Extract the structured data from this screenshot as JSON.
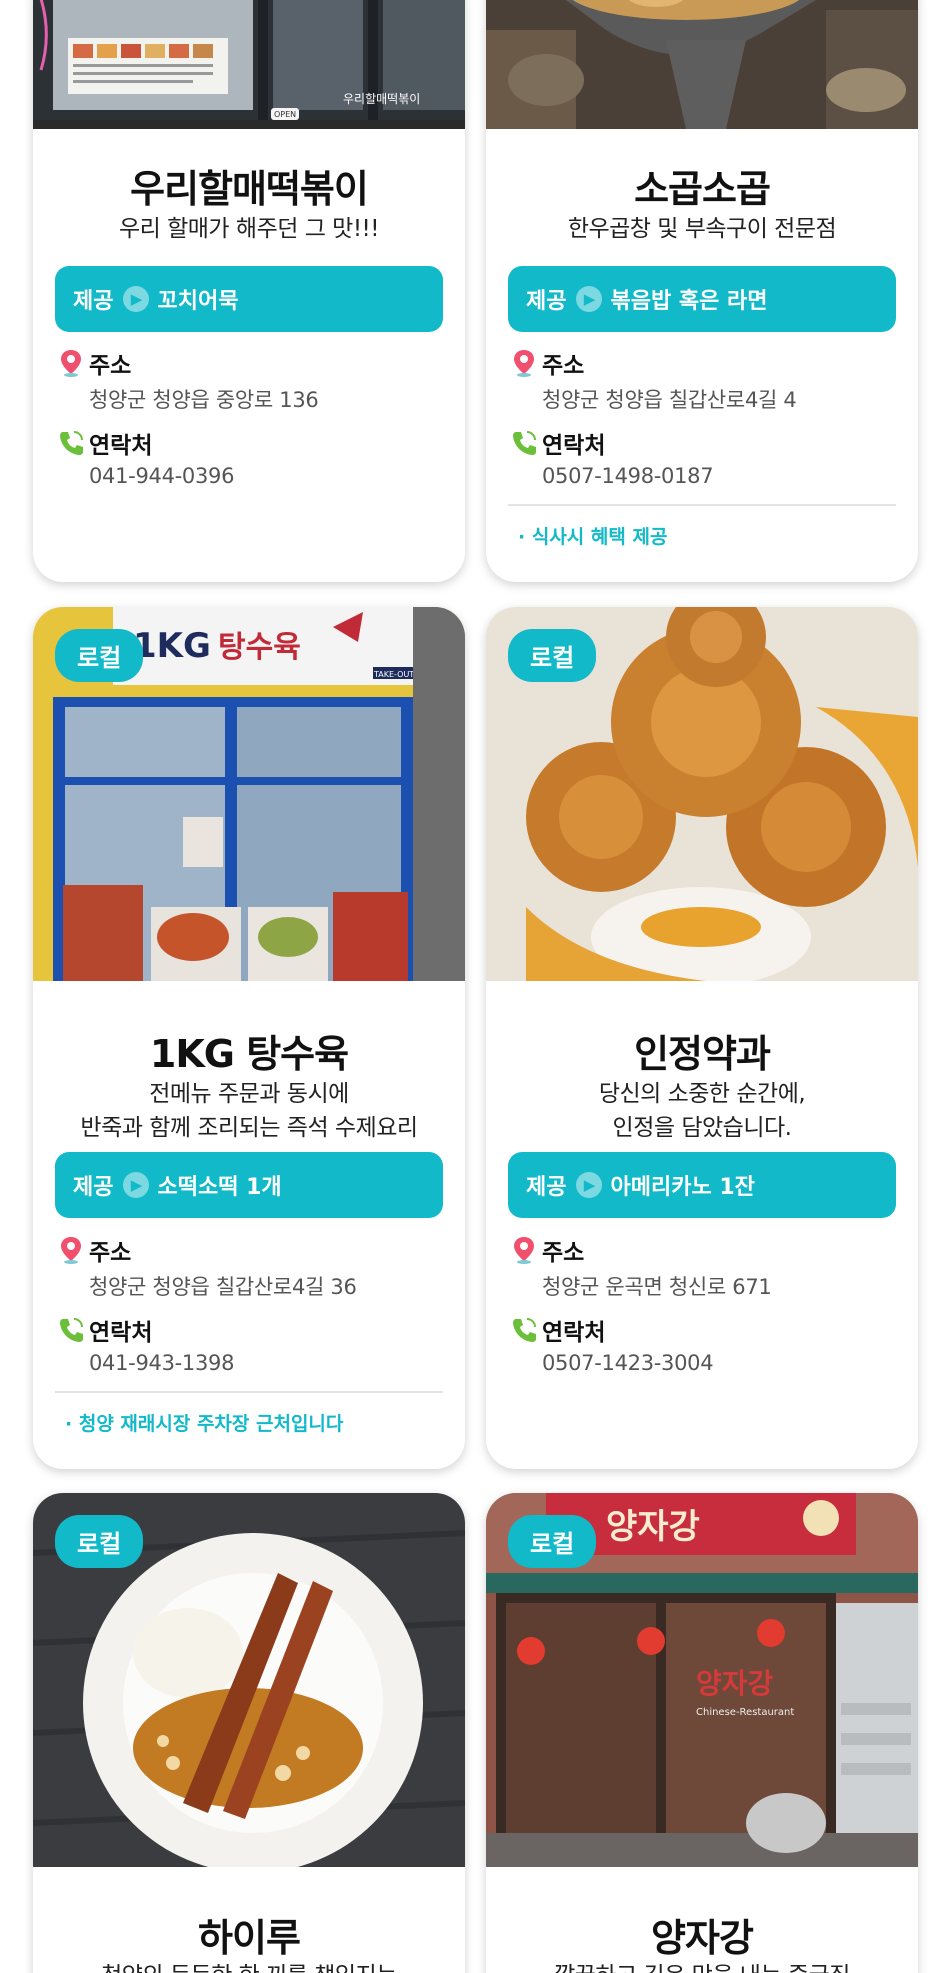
{
  "cards": [
    {
      "name": "우리할매떡볶이",
      "description": [
        "우리 할매가 해주던 그 맛!!!"
      ],
      "offer_label": "제공",
      "offer_item": "꼬치어묵",
      "address_label": "주소",
      "address": "청양군 청양읍 중앙로 136",
      "contact_label": "연락처",
      "phone": "041-944-0396",
      "photo_texts": {
        "window_sign": "우리할매떡볶이",
        "open_sign": "OPEN"
      }
    },
    {
      "name": "소곱소곱",
      "description": [
        "한우곱창 및 부속구이 전문점"
      ],
      "offer_label": "제공",
      "offer_item": "볶음밥 혹은 라면",
      "address_label": "주소",
      "address": "청양군 청양읍 칠갑산로4길 4",
      "contact_label": "연락처",
      "phone": "0507-1498-0187",
      "note": "· 식사시 혜택 제공"
    },
    {
      "badge": "로컬",
      "name": "1KG 탕수육",
      "description": [
        "전메뉴 주문과 동시에",
        "반죽과 함께 조리되는 즉석 수제요리"
      ],
      "offer_label": "제공",
      "offer_item": "소떡소떡 1개",
      "address_label": "주소",
      "address": "청양군 청양읍 칠갑산로4길 36",
      "contact_label": "연락처",
      "phone": "041-943-1398",
      "note": "· 청양 재래시장 주차장 근처입니다",
      "photo_texts": {
        "sign_left": "1KG",
        "sign_right": "탕수육",
        "sign_takeout": "TAKE-OUT"
      }
    },
    {
      "badge": "로컬",
      "name": "인정약과",
      "description": [
        "당신의 소중한 순간에,",
        "인정을 담았습니다."
      ],
      "offer_label": "제공",
      "offer_item": "아메리카노 1잔",
      "address_label": "주소",
      "address": "청양군 운곡면 청신로 671",
      "contact_label": "연락처",
      "phone": "0507-1423-3004"
    },
    {
      "badge": "로컬",
      "name": "하이루",
      "description": [
        "청양의 든든한 한 끼를 책임지는"
      ]
    },
    {
      "badge": "로컬",
      "name": "양자강",
      "description": [
        "깔끔하고 깊은 맛을 내는 중국집"
      ],
      "photo_texts": {
        "sign": "양자강",
        "sub": "Chinese-Restaurant"
      }
    }
  ],
  "colors": {
    "accent": "#12b9c9",
    "pin": "#f0506e",
    "phone_icon": "#6bbf3a"
  }
}
